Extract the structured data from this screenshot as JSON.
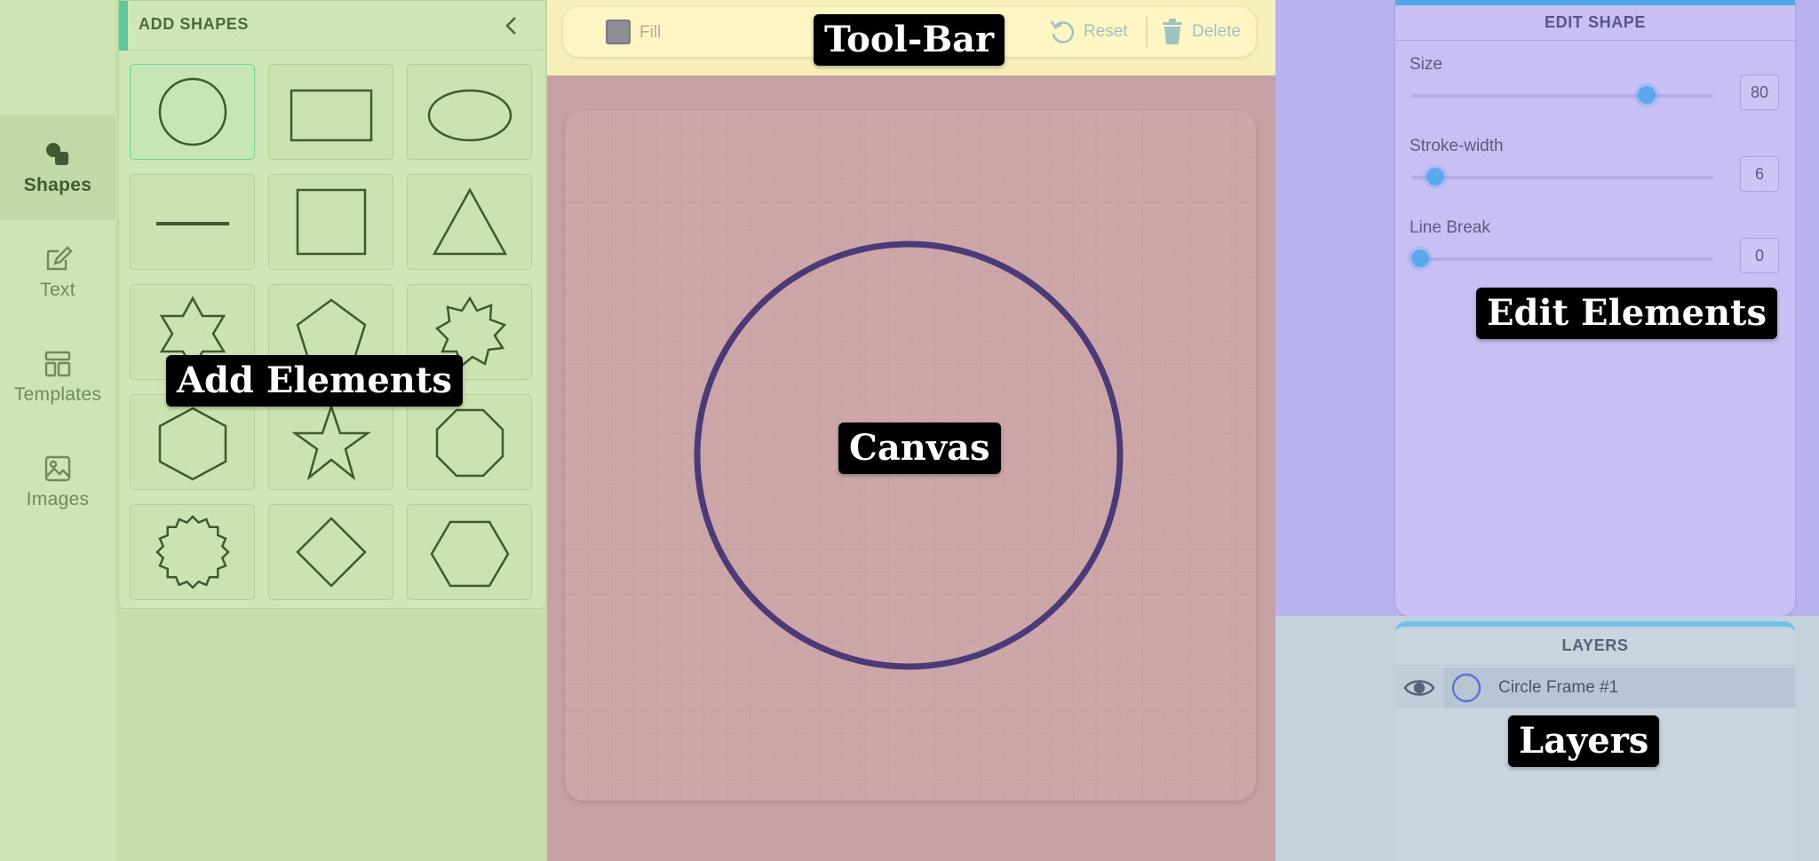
{
  "nav": {
    "items": [
      {
        "label": "Shapes",
        "icon": "shapes-icon",
        "active": true
      },
      {
        "label": "Text",
        "icon": "edit-text-icon",
        "active": false
      },
      {
        "label": "Templates",
        "icon": "templates-icon",
        "active": false
      },
      {
        "label": "Images",
        "icon": "image-icon",
        "active": false
      }
    ]
  },
  "shapes_panel": {
    "title": "ADD SHAPES",
    "collapse_icon": "chevron-left-icon",
    "shapes": [
      "circle",
      "rectangle",
      "ellipse",
      "line",
      "square",
      "triangle",
      "star-six",
      "pentagon",
      "starburst",
      "hexagon",
      "star-five",
      "octagon",
      "seal",
      "diamond",
      "hexagon-flat"
    ]
  },
  "toolbar": {
    "fill_label": "Fill",
    "fill_color": "#8d8c93",
    "reset_label": "Reset",
    "delete_label": "Delete"
  },
  "canvas": {
    "shape": "circle",
    "stroke_color": "#4a3a78"
  },
  "edit_panel": {
    "title": "EDIT SHAPE",
    "sliders": [
      {
        "label": "Size",
        "value": "80",
        "fraction": 0.78
      },
      {
        "label": "Stroke-width",
        "value": "6",
        "fraction": 0.08
      },
      {
        "label": "Line Break",
        "value": "0",
        "fraction": 0.03
      }
    ]
  },
  "layers_panel": {
    "title": "LAYERS",
    "layers": [
      {
        "name": "Circle Frame #1",
        "visible": true
      }
    ]
  },
  "annotations": {
    "toolbar": "Tool-Bar",
    "add": "Add Elements",
    "canvas": "Canvas",
    "edit": "Edit Elements",
    "layers": "Layers"
  }
}
